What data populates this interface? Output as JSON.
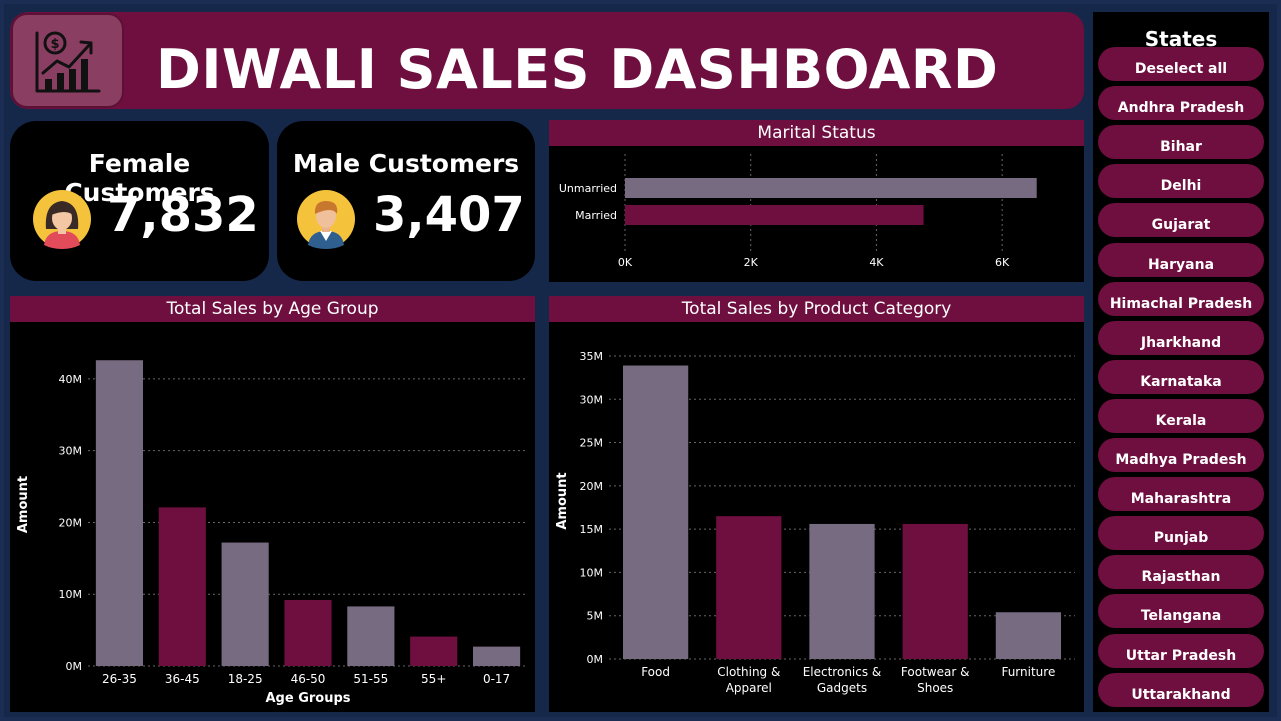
{
  "header": {
    "title": "DIWALI SALES DASHBOARD",
    "logo_icon": "sales-growth-icon"
  },
  "kpis": {
    "female": {
      "label": "Female Customers",
      "value": "7,832",
      "icon": "female-avatar-icon"
    },
    "male": {
      "label": "Male Customers",
      "value": "3,407",
      "icon": "male-avatar-icon"
    }
  },
  "colors": {
    "accent": "#6e0f3f",
    "grey": "#776b81",
    "background": "#000000",
    "page": "#1b2d52"
  },
  "slicer": {
    "title": "States",
    "items": [
      "Deselect all",
      "Andhra Pradesh",
      "Bihar",
      "Delhi",
      "Gujarat",
      "Haryana",
      "Himachal Pradesh",
      "Jharkhand",
      "Karnataka",
      "Kerala",
      "Madhya Pradesh",
      "Maharashtra",
      "Punjab",
      "Rajasthan",
      "Telangana",
      "Uttar Pradesh",
      "Uttarakhand"
    ]
  },
  "chart_data": [
    {
      "type": "bar",
      "orientation": "horizontal",
      "title": "Marital Status",
      "categories": [
        "Unmarried",
        "Married"
      ],
      "values": [
        6550,
        4750
      ],
      "xlim": [
        0,
        7000
      ],
      "ticks": [
        0,
        2000,
        4000,
        6000
      ],
      "tick_labels": [
        "0K",
        "2K",
        "4K",
        "6K"
      ],
      "bar_colors": [
        "#776b81",
        "#6e0f3f"
      ],
      "grid": true
    },
    {
      "type": "bar",
      "title": "Total Sales by Age Group",
      "xlabel": "Age Groups",
      "ylabel": "Amount",
      "categories": [
        "26-35",
        "36-45",
        "18-25",
        "46-50",
        "51-55",
        "55+",
        "0-17"
      ],
      "values": [
        42600000,
        22100000,
        17200000,
        9200000,
        8300000,
        4100000,
        2700000
      ],
      "ylim": [
        0,
        45000000
      ],
      "ticks": [
        0,
        10000000,
        20000000,
        30000000,
        40000000
      ],
      "tick_labels": [
        "0M",
        "10M",
        "20M",
        "30M",
        "40M"
      ],
      "bar_colors": [
        "#776b81",
        "#6e0f3f",
        "#776b81",
        "#6e0f3f",
        "#776b81",
        "#6e0f3f",
        "#776b81"
      ],
      "grid": true
    },
    {
      "type": "bar",
      "title": "Total Sales by Product Category",
      "xlabel": "",
      "ylabel": "Amount",
      "categories": [
        "Food",
        "Clothing & Apparel",
        "Electronics & Gadgets",
        "Footwear & Shoes",
        "Furniture"
      ],
      "category_lines": [
        [
          "Food"
        ],
        [
          "Clothing &",
          "Apparel"
        ],
        [
          "Electronics &",
          "Gadgets"
        ],
        [
          "Footwear &",
          "Shoes"
        ],
        [
          "Furniture"
        ]
      ],
      "values": [
        33900000,
        16500000,
        15600000,
        15600000,
        5400000
      ],
      "ylim": [
        0,
        36500000
      ],
      "ticks": [
        0,
        5000000,
        10000000,
        15000000,
        20000000,
        25000000,
        30000000,
        35000000
      ],
      "tick_labels": [
        "0M",
        "5M",
        "10M",
        "15M",
        "20M",
        "25M",
        "30M",
        "35M"
      ],
      "bar_colors": [
        "#776b81",
        "#6e0f3f",
        "#776b81",
        "#6e0f3f",
        "#776b81"
      ],
      "grid": true
    }
  ]
}
